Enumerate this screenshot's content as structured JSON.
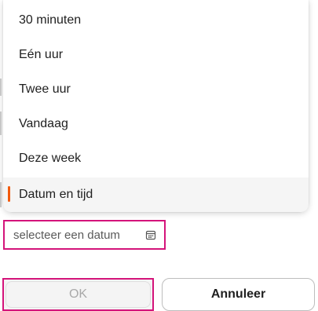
{
  "menu": {
    "items": [
      {
        "label": "30 minuten",
        "selected": false
      },
      {
        "label": "Eén uur",
        "selected": false
      },
      {
        "label": "Twee uur",
        "selected": false
      },
      {
        "label": "Vandaag",
        "selected": false
      },
      {
        "label": "Deze week",
        "selected": false
      },
      {
        "label": "Datum en tijd",
        "selected": true
      }
    ]
  },
  "date_input": {
    "placeholder": "selecteer een datum",
    "icon": "calendar-icon"
  },
  "buttons": {
    "ok_label": "OK",
    "cancel_label": "Annuleer"
  },
  "colors": {
    "accent": "#f25a0d",
    "focus_border": "#d4147a",
    "disabled_text": "#a9a9a9"
  }
}
